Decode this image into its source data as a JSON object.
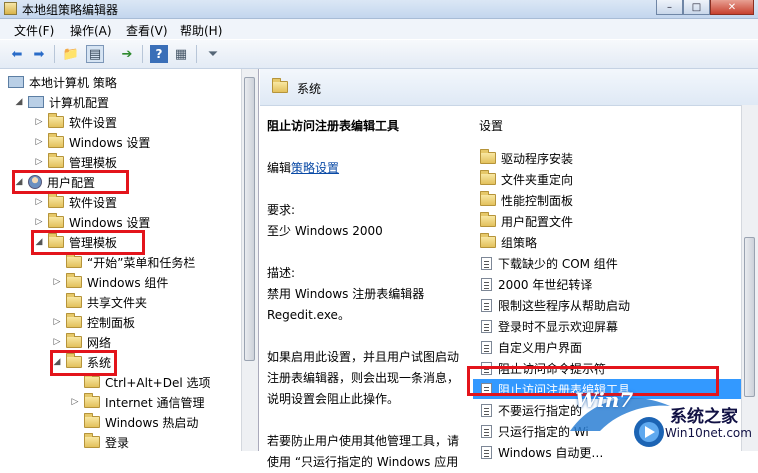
{
  "window": {
    "title": "本地组策略编辑器",
    "buttons": [
      "–",
      "□",
      "✕"
    ]
  },
  "menu": [
    "文件(F)",
    "操作(A)",
    "查看(V)",
    "帮助(H)"
  ],
  "toolbar": {
    "icons": [
      "back-icon",
      "forward-icon",
      "up-folder-icon",
      "show-tree-icon",
      "export-icon",
      "help-icon",
      "properties-icon",
      "filter-icon"
    ]
  },
  "tree": {
    "root": "本地计算机 策略",
    "items": [
      "计算机配置",
      "软件设置",
      "Windows 设置",
      "管理模板",
      "用户配置",
      "软件设置",
      "Windows 设置",
      "管理模板",
      "“开始”菜单和任务栏",
      "Windows 组件",
      "共享文件夹",
      "控制面板",
      "网络",
      "系统",
      "Ctrl+Alt+Del 选项",
      "Internet 通信管理",
      "Windows 热启动",
      "登录"
    ]
  },
  "right": {
    "header_title": "系统",
    "desc": {
      "title": "阻止访问注册表编辑工具",
      "edit_prefix": "编辑",
      "edit_link": "策略设置",
      "req_label": "要求:",
      "req_value": "至少 Windows 2000",
      "desc_label": "描述:",
      "desc_line1": "禁用 Windows 注册表编辑器",
      "desc_line2": "Regedit.exe。",
      "para_line1": "如果启用此设置，并且用户试图启动",
      "para_line2": "注册表编辑器，则会出现一条消息，",
      "para_line3": "说明设置会阻止此操作。",
      "para2_line1": "若要防止用户使用其他管理工具，请",
      "para2_line2": "使用 “只运行指定的 Windows 应用"
    },
    "list_header": "设置",
    "list": [
      {
        "label": "驱动程序安装",
        "type": "folder"
      },
      {
        "label": "文件夹重定向",
        "type": "folder"
      },
      {
        "label": "性能控制面板",
        "type": "folder"
      },
      {
        "label": "用户配置文件",
        "type": "folder"
      },
      {
        "label": "组策略",
        "type": "folder"
      },
      {
        "label": "下载缺少的 COM 组件",
        "type": "setting"
      },
      {
        "label": "2000 年世纪转译",
        "type": "setting"
      },
      {
        "label": "限制这些程序从帮助启动",
        "type": "setting"
      },
      {
        "label": "登录时不显示欢迎屏幕",
        "type": "setting"
      },
      {
        "label": "自定义用户界面",
        "type": "setting"
      },
      {
        "label": "阻止访问命令提示符",
        "type": "setting"
      },
      {
        "label": "阻止访问注册表编辑工具",
        "type": "setting",
        "selected": true
      },
      {
        "label": "不要运行指定的",
        "type": "setting"
      },
      {
        "label": "只运行指定的 Wi",
        "type": "setting"
      },
      {
        "label": "Windows 自动更…",
        "type": "setting"
      }
    ]
  },
  "watermark": {
    "brand": "系统之家",
    "url": "Win10net.com",
    "logo_text": "Win7"
  },
  "colors": {
    "highlight_box": "#e3141b",
    "selection": "#3399ff",
    "link": "#0a4aa6"
  }
}
